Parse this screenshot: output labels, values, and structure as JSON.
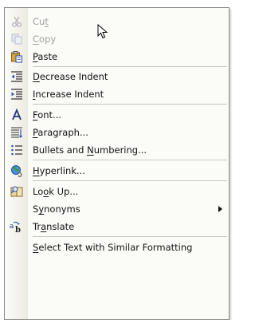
{
  "menu": {
    "items": [
      {
        "label": "Cut",
        "u": 2,
        "icon": "scissors-icon",
        "disabled": true
      },
      {
        "label": "Copy",
        "u": 0,
        "icon": "copy-icon",
        "disabled": true
      },
      {
        "label": "Paste",
        "u": 0,
        "icon": "paste-icon",
        "disabled": false
      },
      {
        "label": "Decrease Indent",
        "u": 0,
        "icon": "decrease-indent-icon",
        "disabled": false
      },
      {
        "label": "Increase Indent",
        "u": 0,
        "icon": "increase-indent-icon",
        "disabled": false
      },
      {
        "label": "Font...",
        "u": 0,
        "icon": "font-icon",
        "disabled": false
      },
      {
        "label": "Paragraph...",
        "u": 0,
        "icon": "paragraph-icon",
        "disabled": false
      },
      {
        "label": "Bullets and Numbering...",
        "u": 12,
        "icon": "bullets-icon",
        "disabled": false
      },
      {
        "label": "Hyperlink...",
        "u": 0,
        "icon": "hyperlink-icon",
        "disabled": false
      },
      {
        "label": "Look Up...",
        "u": 2,
        "icon": "lookup-icon",
        "disabled": false
      },
      {
        "label": "Synonyms",
        "u": 1,
        "icon": "",
        "disabled": false,
        "submenu": true
      },
      {
        "label": "Translate",
        "u": 2,
        "icon": "translate-icon",
        "disabled": false
      },
      {
        "label": "Select Text with Similar Formatting",
        "u": 0,
        "icon": "",
        "disabled": false
      }
    ]
  },
  "colors": {
    "menu_background": "#fbfbf8",
    "border": "#8a8a8a",
    "disabled_text": "#a0a0a0",
    "separator": "#c5c5c0"
  }
}
